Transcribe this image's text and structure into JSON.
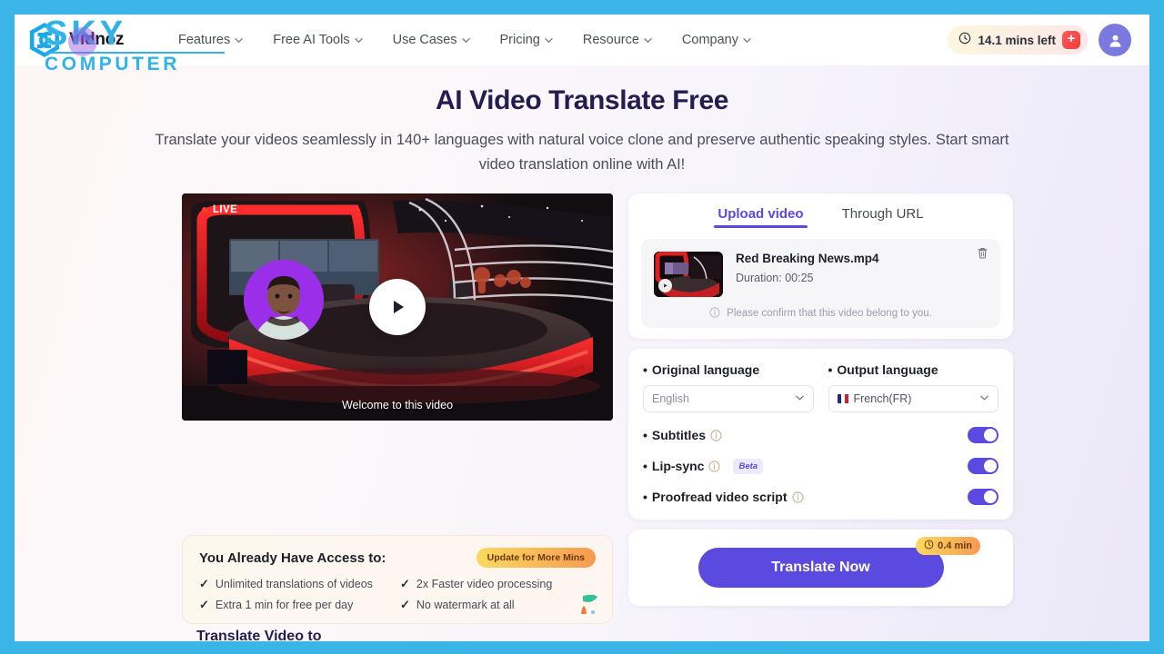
{
  "watermark": {
    "line1": "SKY",
    "line2": "COMPUTER"
  },
  "nav": {
    "brand": "Vidnoz",
    "links": [
      {
        "label": "Features"
      },
      {
        "label": "Free AI Tools"
      },
      {
        "label": "Use Cases"
      },
      {
        "label": "Pricing"
      },
      {
        "label": "Resource"
      },
      {
        "label": "Company"
      }
    ],
    "mins_left": "14.1 mins left",
    "plus_label": "+"
  },
  "hero": {
    "title": "AI Video Translate Free",
    "subtitle": "Translate your videos seamlessly in 140+ languages with natural voice clone and preserve authentic speaking styles. Start smart video translation online with AI!"
  },
  "video": {
    "live_label": "LIVE",
    "caption": "Welcome to this video"
  },
  "access": {
    "title": "You Already Have Access to:",
    "update_label": "Update for More Mins",
    "benefits": [
      "Unlimited translations of videos",
      "2x Faster video processing",
      "Extra 1 min for free per day",
      "No watermark at all"
    ]
  },
  "upload": {
    "tabs": [
      {
        "label": "Upload video",
        "active": true
      },
      {
        "label": "Through URL",
        "active": false
      }
    ],
    "file_name": "Red Breaking News.mp4",
    "duration_label": "Duration:  00:25",
    "confirm_note": "Please confirm that this video belong to you."
  },
  "settings": {
    "original_label": "Original language",
    "original_value": "English",
    "output_label": "Output language",
    "output_value": "French(FR)",
    "subtitles_label": "Subtitles",
    "lipsync_label": "Lip-sync",
    "lipsync_badge": "Beta",
    "proofread_label": "Proofread video script",
    "bullet": "•"
  },
  "action": {
    "translate_label": "Translate Now",
    "cost_label": "0.4 min"
  },
  "bottom": {
    "heading": "Translate Video to"
  },
  "colors": {
    "accent": "#5b4ae0",
    "frame_blue": "#3bb5e8",
    "watermark_blue": "#2fb3ea",
    "badge_gold": "#fbd95f",
    "badge_orange": "#f79a52",
    "plus_red": "#f23b3b"
  }
}
